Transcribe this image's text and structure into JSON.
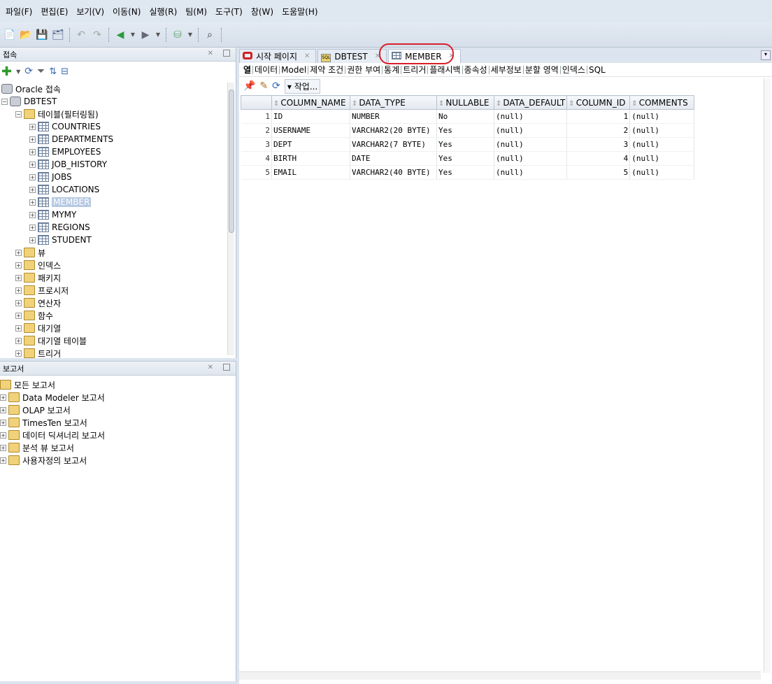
{
  "menu": [
    "파일(F)",
    "편집(E)",
    "보기(V)",
    "이동(N)",
    "실행(R)",
    "팀(M)",
    "도구(T)",
    "창(W)",
    "도움말(H)"
  ],
  "connections_panel": {
    "title": "접속",
    "tree": [
      {
        "label": "Oracle 접속",
        "level": 0,
        "icon": "db-icon",
        "exp": ""
      },
      {
        "label": "DBTEST",
        "level": 0,
        "icon": "connection-icon",
        "exp": "−"
      },
      {
        "label": "테이블(필터링됨)",
        "level": 1,
        "icon": "tables-folder-icon",
        "exp": "−"
      },
      {
        "label": "COUNTRIES",
        "level": 2,
        "icon": "table-icon",
        "exp": "+"
      },
      {
        "label": "DEPARTMENTS",
        "level": 2,
        "icon": "table-icon",
        "exp": "+"
      },
      {
        "label": "EMPLOYEES",
        "level": 2,
        "icon": "table-icon",
        "exp": "+"
      },
      {
        "label": "JOB_HISTORY",
        "level": 2,
        "icon": "table-icon",
        "exp": "+"
      },
      {
        "label": "JOBS",
        "level": 2,
        "icon": "table-icon",
        "exp": "+"
      },
      {
        "label": "LOCATIONS",
        "level": 2,
        "icon": "table-icon",
        "exp": "+"
      },
      {
        "label": "MEMBER",
        "level": 2,
        "icon": "table-icon",
        "exp": "+",
        "selected": true
      },
      {
        "label": "MYMY",
        "level": 2,
        "icon": "table-icon",
        "exp": "+"
      },
      {
        "label": "REGIONS",
        "level": 2,
        "icon": "table-icon",
        "exp": "+"
      },
      {
        "label": "STUDENT",
        "level": 2,
        "icon": "table-icon",
        "exp": "+"
      },
      {
        "label": "뷰",
        "level": 1,
        "icon": "folder-icon",
        "exp": "+"
      },
      {
        "label": "인덱스",
        "level": 1,
        "icon": "folder-icon",
        "exp": "+"
      },
      {
        "label": "패키지",
        "level": 1,
        "icon": "folder-icon",
        "exp": "+"
      },
      {
        "label": "프로시저",
        "level": 1,
        "icon": "folder-icon",
        "exp": "+"
      },
      {
        "label": "연산자",
        "level": 1,
        "icon": "folder-icon",
        "exp": "+"
      },
      {
        "label": "함수",
        "level": 1,
        "icon": "folder-icon",
        "exp": "+"
      },
      {
        "label": "대기열",
        "level": 1,
        "icon": "folder-icon",
        "exp": "+"
      },
      {
        "label": "대기열 테이블",
        "level": 1,
        "icon": "folder-icon",
        "exp": "+"
      },
      {
        "label": "트리거",
        "level": 1,
        "icon": "folder-icon",
        "exp": "+"
      }
    ]
  },
  "reports_panel": {
    "title": "보고서",
    "tree": [
      {
        "label": "모든 보고서",
        "level": 0,
        "exp": ""
      },
      {
        "label": "Data Modeler 보고서",
        "level": 0,
        "exp": "+"
      },
      {
        "label": "OLAP 보고서",
        "level": 0,
        "exp": "+"
      },
      {
        "label": "TimesTen 보고서",
        "level": 0,
        "exp": "+"
      },
      {
        "label": "데이터 딕셔너리 보고서",
        "level": 0,
        "exp": "+"
      },
      {
        "label": "분석 뷰 보고서",
        "level": 0,
        "exp": "+"
      },
      {
        "label": "사용자정의 보고서",
        "level": 0,
        "exp": "+"
      }
    ]
  },
  "editor": {
    "tabs": [
      {
        "label": "시작 페이지",
        "icon": "oracle-icon"
      },
      {
        "label": "DBTEST",
        "icon": "sql-icon"
      },
      {
        "label": "MEMBER",
        "icon": "table-icon",
        "active": true
      }
    ],
    "subtabs": [
      "열",
      "데이터",
      "Model",
      "제약 조건",
      "권한 부여",
      "통계",
      "트리거",
      "플래시백",
      "종속성",
      "세부정보",
      "분할 영역",
      "인덱스",
      "SQL"
    ],
    "actions_label": "작업...",
    "columns": [
      "COLUMN_NAME",
      "DATA_TYPE",
      "NULLABLE",
      "DATA_DEFAULT",
      "COLUMN_ID",
      "COMMENTS"
    ],
    "rows": [
      {
        "n": "1",
        "name": "ID",
        "type": "NUMBER",
        "nullable": "No",
        "default": "(null)",
        "id": "1",
        "comments": "(null)"
      },
      {
        "n": "2",
        "name": "USERNAME",
        "type": "VARCHAR2(20 BYTE)",
        "nullable": "Yes",
        "default": "(null)",
        "id": "2",
        "comments": "(null)"
      },
      {
        "n": "3",
        "name": "DEPT",
        "type": "VARCHAR2(7 BYTE)",
        "nullable": "Yes",
        "default": "(null)",
        "id": "3",
        "comments": "(null)"
      },
      {
        "n": "4",
        "name": "BIRTH",
        "type": "DATE",
        "nullable": "Yes",
        "default": "(null)",
        "id": "4",
        "comments": "(null)"
      },
      {
        "n": "5",
        "name": "EMAIL",
        "type": "VARCHAR2(40 BYTE)",
        "nullable": "Yes",
        "default": "(null)",
        "id": "5",
        "comments": "(null)"
      }
    ]
  },
  "colors": {
    "highlight_circle": "#d8202a",
    "selection": "#b7c9e2"
  }
}
